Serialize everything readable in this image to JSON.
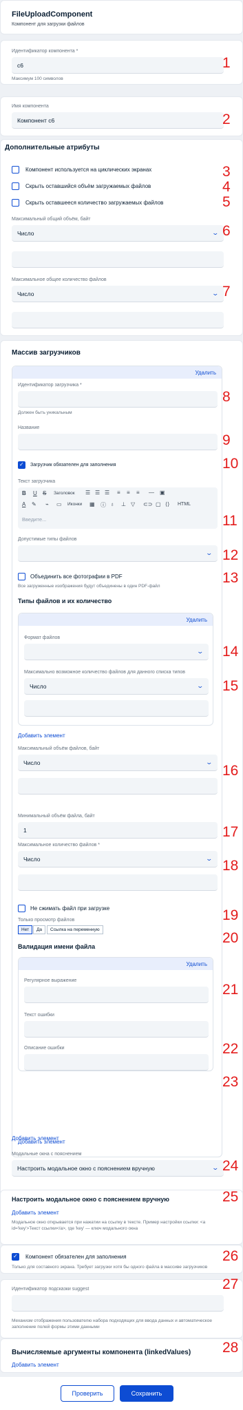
{
  "component": {
    "title": "FileUploadComponent",
    "subtitle": "Компонент для загрузки файлов"
  },
  "id_field": {
    "label": "Идентификатор компонента *",
    "value": "c6",
    "hint": "Максимум 100 символов"
  },
  "name_field": {
    "label": "Имя компонента",
    "value": "Компонент с6"
  },
  "extra": {
    "heading": "Дополнительные атрибуты",
    "checkboxes": [
      {
        "label": "Компонент используется на циклических экранах",
        "checked": false
      },
      {
        "label": "Скрыть оставшийся объём загружаемых файлов",
        "checked": false
      },
      {
        "label": "Скрыть оставшееся количество загружаемых файлов",
        "checked": false
      }
    ],
    "max_volume": {
      "label": "Максимальный общий объём, байт",
      "value": "Число"
    },
    "max_count": {
      "label": "Максимальное общее количество файлов",
      "value": "Число"
    }
  },
  "uploaders": {
    "heading": "Массив загрузчиков",
    "delete_label": "Удалить",
    "id_label": "Идентификатор загрузчика *",
    "id_hint": "Должен быть уникальным",
    "name_label": "Название",
    "required_label": "Загрузчик обязателен для заполнения",
    "text_label": "Текст загрузчика",
    "toolbar": {
      "headings": "Заголовок",
      "icons": "Иконки",
      "html": "HTML"
    },
    "text_placeholder": "Введите...",
    "allowed_types_label": "Допустимые типы файлов",
    "merge_label": "Объединить все фотографии в PDF",
    "merge_hint": "Все загруженные изображения будут объединены в один PDF-файл",
    "types_heading": "Типы файлов и их количество",
    "types_delete": "Удалить",
    "format_label": "Формат файлов",
    "max_files_type_label": "Максимально возможное количество файлов для данного списка типов",
    "max_files_type_value": "Число",
    "add_element": "Добавить элемент",
    "max_file_size_label": "Максимальный объём файлов, байт",
    "max_file_size_value": "Число",
    "min_file_size_label": "Минимальный объём файла, байт",
    "min_file_size_value": "1",
    "max_count_label": "Максимальное количество файлов *",
    "max_count_value": "Число",
    "no_compress_label": "Не сжимать файл при загрузке",
    "view_only_label": "Только просмотр файлов",
    "view_only_options": [
      "Нет",
      "Да",
      "Ссылка на переменную"
    ],
    "validation_heading": "Валидация имени файла",
    "validation_delete": "Удалить",
    "regex_label": "Регулярное выражение",
    "error_text_label": "Текст ошибки",
    "error_desc_label": "Описание ошибки",
    "validation_add": "Добавить элемент",
    "uploaders_add": "Добавить элемент"
  },
  "modal": {
    "label": "Модальные окна с пояснением",
    "value": "Настроить модальное окно с пояснением вручную",
    "heading": "Настроить модальное окно с пояснением вручную",
    "add": "Добавить элемент",
    "hint": "Модальное окно открывается при нажатии на ссылку в тексте. Пример настройки ссылки: <a id='key'>Текст ссылки</a>, где 'key' — ключ модального окна"
  },
  "required": {
    "label": "Компонент обязателен для заполнения",
    "checked": true,
    "hint": "Только для составного экрана. Требует загрузки хотя бы одного файла в массиве загрузчиков"
  },
  "suggest": {
    "label": "Идентификатор подсказки suggest",
    "hint": "Механизм отображения пользователю набора подходящих для ввода данных и автоматическое заполнение полей формы этими данными"
  },
  "linked": {
    "heading": "Вычисляемые аргументы компонента (linkedValues)",
    "add": "Добавить элемент"
  },
  "footer": {
    "check": "Проверить",
    "save": "Сохранить"
  },
  "markers": [
    "1",
    "2",
    "3",
    "4",
    "5",
    "6",
    "7",
    "8",
    "9",
    "10",
    "11",
    "12",
    "13",
    "14",
    "15",
    "16",
    "17",
    "18",
    "19",
    "20",
    "21",
    "22",
    "23",
    "24",
    "25",
    "26",
    "27",
    "28"
  ],
  "colors": {
    "accent": "#0d4cd3",
    "marker": "#e31b1b"
  }
}
